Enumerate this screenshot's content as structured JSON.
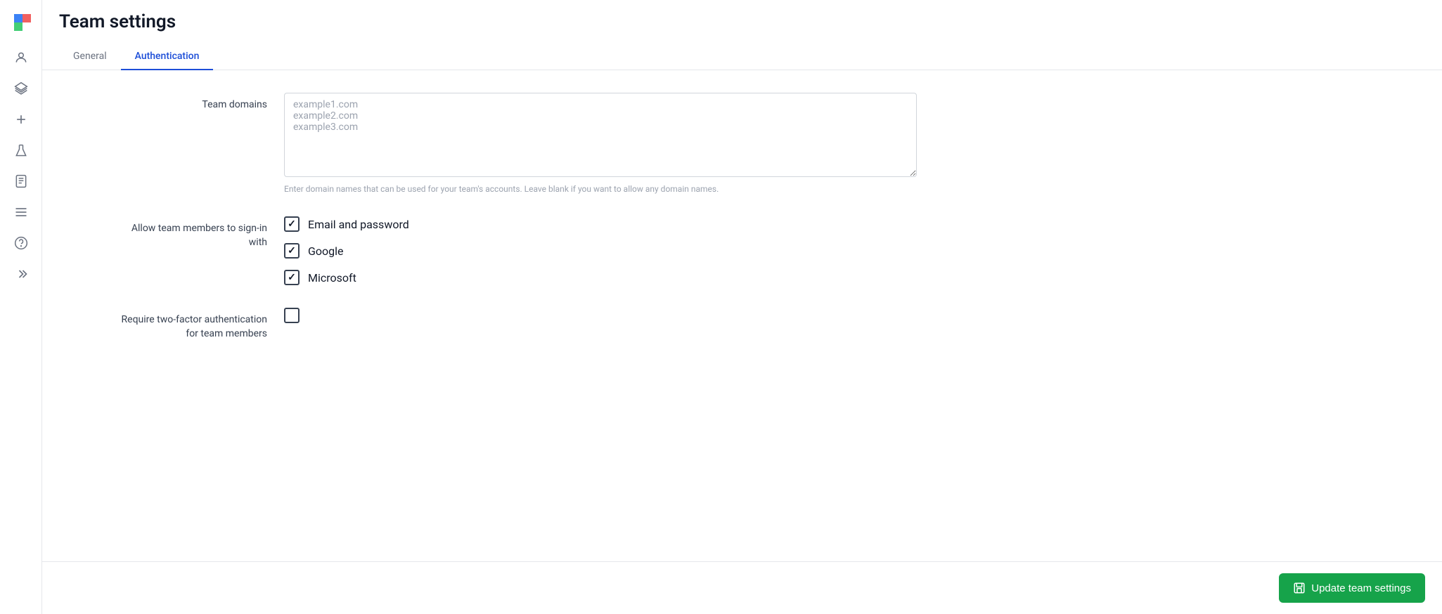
{
  "app": {
    "title": "Team settings"
  },
  "tabs": [
    {
      "id": "general",
      "label": "General",
      "active": false
    },
    {
      "id": "authentication",
      "label": "Authentication",
      "active": true
    }
  ],
  "sidebar": {
    "icons": [
      {
        "name": "person-icon",
        "glyph": "person"
      },
      {
        "name": "layers-icon",
        "glyph": "layers"
      },
      {
        "name": "plus-icon",
        "glyph": "plus"
      },
      {
        "name": "flask-icon",
        "glyph": "flask"
      },
      {
        "name": "document-icon",
        "glyph": "document"
      },
      {
        "name": "menu-icon",
        "glyph": "menu"
      },
      {
        "name": "help-icon",
        "glyph": "help"
      },
      {
        "name": "chevron-right-icon",
        "glyph": "chevron"
      }
    ]
  },
  "form": {
    "team_domains_label": "Team domains",
    "team_domains_placeholder": "example1.com\nexample2.com\nexample3.com",
    "team_domains_help": "Enter domain names that can be used for your team's accounts. Leave blank if you want to allow any domain names.",
    "signin_label": "Allow team members to sign-in\nwith",
    "signin_options": [
      {
        "id": "email-password",
        "label": "Email and password",
        "checked": true
      },
      {
        "id": "google",
        "label": "Google",
        "checked": true
      },
      {
        "id": "microsoft",
        "label": "Microsoft",
        "checked": true
      }
    ],
    "twofa_label": "Require two-factor authentication\nfor team members",
    "twofa_checked": false
  },
  "footer": {
    "update_button_label": "Update team settings"
  }
}
